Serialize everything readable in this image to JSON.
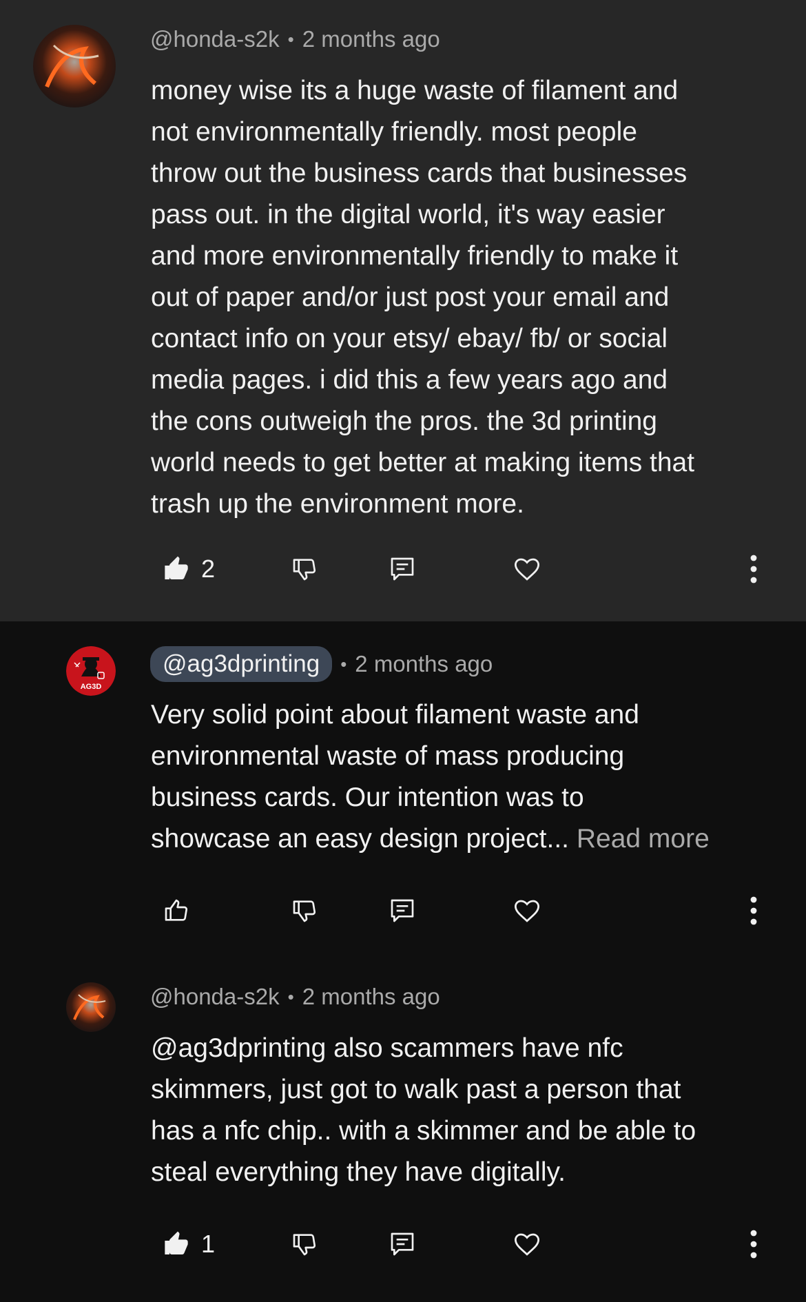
{
  "comments": [
    {
      "author": "@honda-s2k",
      "separator": "•",
      "time": "2 months ago",
      "body_lines": [
        "money wise its a huge waste of filament and",
        "not environmentally friendly.  most people",
        "throw out the business cards that businesses",
        "pass out. in the digital world, it's way easier",
        "and more environmentally friendly to make it",
        "out of paper and/or just post your email and",
        "contact info on your etsy/ ebay/ fb/ or social",
        "media pages. i did this a few years ago and",
        "the cons outweigh the pros. the 3d printing",
        "world needs to get better at making items that",
        "trash up the environment more."
      ],
      "like_count": "2",
      "liked": true
    },
    {
      "author": "@ag3dprinting",
      "separator": "•",
      "time": "2 months ago",
      "body_lines": [
        "Very solid point about filament waste and",
        "environmental waste of mass producing",
        "business cards. Our intention was to",
        "showcase an easy design project..."
      ],
      "read_more": "Read more",
      "avatar_text": "AG3D",
      "like_count": "",
      "liked": false
    },
    {
      "author": "@honda-s2k",
      "separator": "•",
      "time": "2 months ago",
      "body_lines": [
        "@ag3dprinting also scammers have nfc",
        "skimmers, just got to walk past a person that",
        "has a nfc chip.. with a skimmer and be able to",
        "steal everything they have digitally."
      ],
      "like_count": "1",
      "liked": true
    }
  ],
  "icons": {
    "like": "thumbs-up-icon",
    "dislike": "thumbs-down-icon",
    "reply": "reply-icon",
    "heart": "heart-icon",
    "more": "more-vert-icon"
  },
  "colors": {
    "highlight_bg": "#272727",
    "page_bg": "#0f0f0f",
    "text": "#f1f1f1",
    "secondary_text": "#aaaaaa",
    "author_chip": "#3d4756"
  }
}
